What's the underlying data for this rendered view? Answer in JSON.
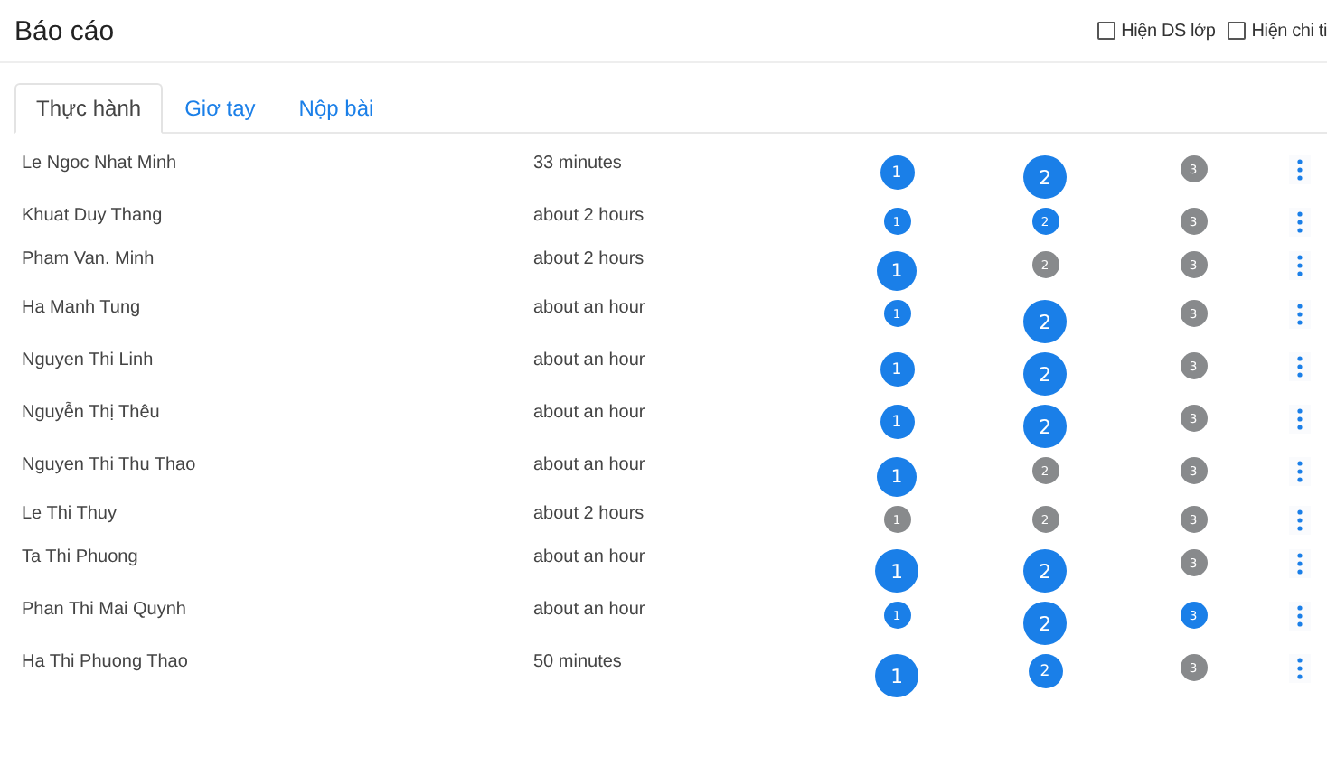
{
  "header": {
    "title": "Báo cáo",
    "options": [
      {
        "label": "Hiện DS lớp",
        "checked": false
      },
      {
        "label": "Hiện chi ti",
        "checked": false
      }
    ]
  },
  "tabs": [
    {
      "label": "Thực hành",
      "selected": true
    },
    {
      "label": "Giơ tay",
      "selected": false
    },
    {
      "label": "Nộp bài",
      "selected": false
    }
  ],
  "rows": [
    {
      "name": "Le Ngoc Nhat Minh",
      "time": "33 minutes",
      "steps": [
        {
          "label": "1",
          "done": true,
          "kind": "md"
        },
        {
          "label": "2",
          "done": true,
          "kind": "xl"
        },
        {
          "label": "3",
          "done": false,
          "kind": "sm"
        }
      ]
    },
    {
      "name": "Khuat Duy Thang",
      "time": "about 2 hours",
      "steps": [
        {
          "label": "1",
          "done": true,
          "kind": "sm"
        },
        {
          "label": "2",
          "done": true,
          "kind": "sm"
        },
        {
          "label": "3",
          "done": false,
          "kind": "sm"
        }
      ]
    },
    {
      "name": "Pham Van. Minh",
      "time": "about 2 hours",
      "steps": [
        {
          "label": "1",
          "done": true,
          "kind": "lg"
        },
        {
          "label": "2",
          "done": false,
          "kind": "sm"
        },
        {
          "label": "3",
          "done": false,
          "kind": "sm"
        }
      ]
    },
    {
      "name": "Ha Manh Tung",
      "time": "about an hour",
      "steps": [
        {
          "label": "1",
          "done": true,
          "kind": "sm"
        },
        {
          "label": "2",
          "done": true,
          "kind": "xl"
        },
        {
          "label": "3",
          "done": false,
          "kind": "sm"
        }
      ]
    },
    {
      "name": "Nguyen Thi Linh",
      "time": "about an hour",
      "steps": [
        {
          "label": "1",
          "done": true,
          "kind": "md"
        },
        {
          "label": "2",
          "done": true,
          "kind": "xl"
        },
        {
          "label": "3",
          "done": false,
          "kind": "sm"
        }
      ]
    },
    {
      "name": "Nguyễn Thị Thêu",
      "time": "about an hour",
      "steps": [
        {
          "label": "1",
          "done": true,
          "kind": "md"
        },
        {
          "label": "2",
          "done": true,
          "kind": "xl"
        },
        {
          "label": "3",
          "done": false,
          "kind": "sm"
        }
      ]
    },
    {
      "name": "Nguyen Thi Thu Thao",
      "time": "about an hour",
      "steps": [
        {
          "label": "1",
          "done": true,
          "kind": "lg"
        },
        {
          "label": "2",
          "done": false,
          "kind": "sm"
        },
        {
          "label": "3",
          "done": false,
          "kind": "sm"
        }
      ]
    },
    {
      "name": "Le Thi Thuy",
      "time": "about 2 hours",
      "steps": [
        {
          "label": "1",
          "done": false,
          "kind": "sm"
        },
        {
          "label": "2",
          "done": false,
          "kind": "sm"
        },
        {
          "label": "3",
          "done": false,
          "kind": "sm"
        }
      ]
    },
    {
      "name": "Ta Thi Phuong",
      "time": "about an hour",
      "steps": [
        {
          "label": "1",
          "done": true,
          "kind": "xl"
        },
        {
          "label": "2",
          "done": true,
          "kind": "xl"
        },
        {
          "label": "3",
          "done": false,
          "kind": "sm"
        }
      ]
    },
    {
      "name": "Phan Thi Mai Quynh",
      "time": "about an hour",
      "steps": [
        {
          "label": "1",
          "done": true,
          "kind": "sm"
        },
        {
          "label": "2",
          "done": true,
          "kind": "xl"
        },
        {
          "label": "3",
          "done": true,
          "kind": "sm"
        }
      ]
    },
    {
      "name": "Ha Thi Phuong Thao",
      "time": "50 minutes",
      "steps": [
        {
          "label": "1",
          "done": true,
          "kind": "xl"
        },
        {
          "label": "2",
          "done": true,
          "kind": "md"
        },
        {
          "label": "3",
          "done": false,
          "kind": "sm"
        }
      ]
    }
  ]
}
